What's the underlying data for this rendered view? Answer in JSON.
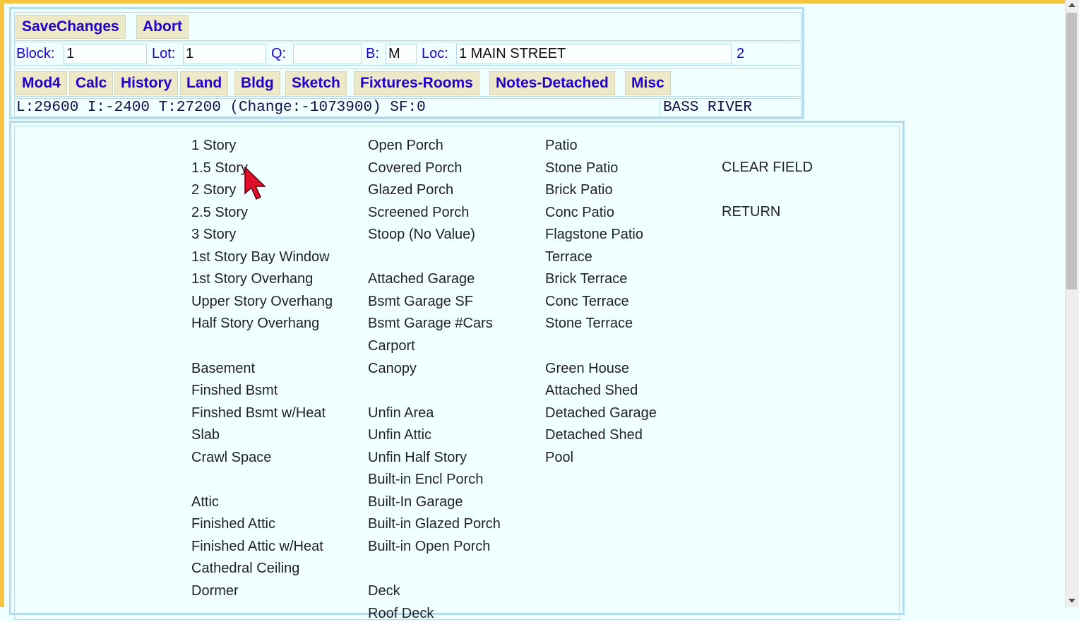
{
  "toolbar": {
    "save_label": "SaveChanges",
    "abort_label": "Abort"
  },
  "parcel": {
    "block_label": "Block:",
    "block_value": "1",
    "lot_label": "Lot:",
    "lot_value": "1",
    "q_label": "Q:",
    "q_value": "",
    "b_label": "B:",
    "b_value": "M",
    "loc_label": "Loc:",
    "loc_value": "1 MAIN STREET",
    "card": "2"
  },
  "tabs": [
    {
      "label": "Mod4"
    },
    {
      "label": "Calc"
    },
    {
      "label": "History"
    },
    {
      "label": "Land"
    },
    {
      "label": "Bldg"
    },
    {
      "label": "Sketch"
    },
    {
      "label": "Fixtures-Rooms"
    },
    {
      "label": "Notes-Detached"
    },
    {
      "label": "Misc"
    }
  ],
  "summary": {
    "values": "L:29600 I:-2400 T:27200 (Change:-1073900) SF:0",
    "owner": "BASS RIVER"
  },
  "options": {
    "col1": [
      "1 Story",
      "1.5 Story",
      "2 Story",
      "2.5 Story",
      "3 Story",
      "1st Story Bay Window",
      "1st Story Overhang",
      "Upper Story Overhang",
      "Half Story Overhang",
      "",
      "Basement",
      "Finshed Bsmt",
      "Finshed Bsmt w/Heat",
      "Slab",
      "Crawl Space",
      "",
      "Attic",
      "Finished Attic",
      "Finished Attic w/Heat",
      "Cathedral Ceiling",
      "Dormer"
    ],
    "col2": [
      "Open Porch",
      "Covered Porch",
      "Glazed Porch",
      "Screened Porch",
      "Stoop (No Value)",
      "",
      "Attached Garage",
      "Bsmt Garage SF",
      "Bsmt Garage #Cars",
      "Carport",
      "Canopy",
      "",
      "Unfin Area",
      "Unfin Attic",
      "Unfin Half Story",
      "Built-in Encl Porch",
      "Built-In Garage",
      "Built-in Glazed Porch",
      "Built-in Open Porch",
      "",
      "Deck",
      "Roof Deck"
    ],
    "col3": [
      "Patio",
      "Stone Patio",
      "Brick Patio",
      "Conc Patio",
      "Flagstone Patio",
      "Terrace",
      "Brick Terrace",
      "Conc Terrace",
      "Stone Terrace",
      "",
      "Green House",
      "Attached Shed",
      "Detached Garage",
      "Detached Shed",
      "Pool"
    ],
    "clear_label": "CLEAR FIELD",
    "return_label": "RETURN"
  }
}
